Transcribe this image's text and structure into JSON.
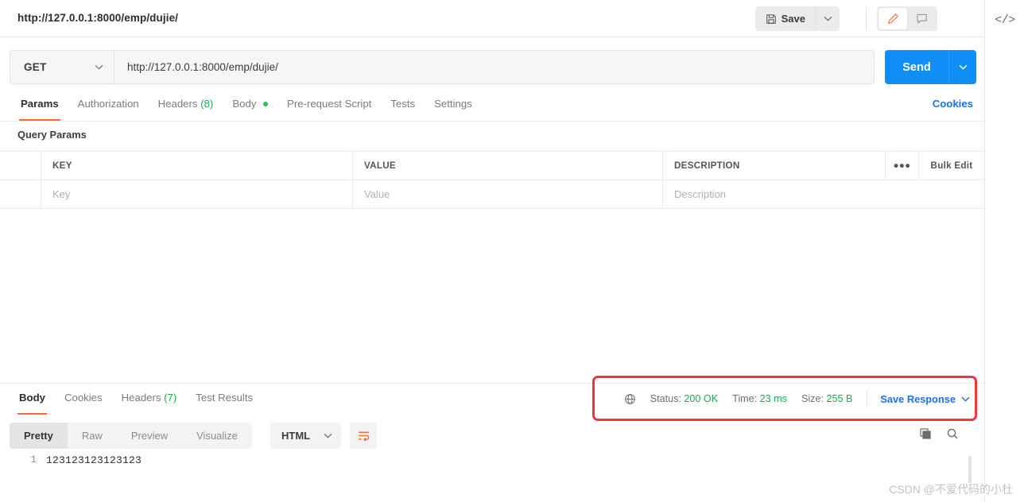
{
  "titlebar": {
    "tab_url": "http://127.0.0.1:8000/emp/dujie/",
    "save_label": "Save",
    "save_icon": "floppy-disk-icon",
    "save_caret_icon": "chevron-down-icon",
    "edit_icon": "pencil-icon",
    "comment_icon": "comment-icon",
    "code_icon": "code-brackets-icon",
    "accent_orange": "#ff6c37"
  },
  "request": {
    "method": "GET",
    "method_caret_icon": "chevron-down-icon",
    "url": "http://127.0.0.1:8000/emp/dujie/",
    "send_label": "Send",
    "send_caret_icon": "chevron-down-icon",
    "send_color": "#0f8ff5"
  },
  "request_tabs": {
    "items": [
      {
        "label": "Params",
        "active": true,
        "count": "",
        "dot": false
      },
      {
        "label": "Authorization",
        "active": false,
        "count": "",
        "dot": false
      },
      {
        "label": "Headers",
        "active": false,
        "count": "(8)",
        "dot": false
      },
      {
        "label": "Body",
        "active": false,
        "count": "",
        "dot": true
      },
      {
        "label": "Pre-request Script",
        "active": false,
        "count": "",
        "dot": false
      },
      {
        "label": "Tests",
        "active": false,
        "count": "",
        "dot": false
      },
      {
        "label": "Settings",
        "active": false,
        "count": "",
        "dot": false
      }
    ],
    "cookies_link": "Cookies"
  },
  "query_params": {
    "section_title": "Query Params",
    "columns": [
      "KEY",
      "VALUE",
      "DESCRIPTION"
    ],
    "more_icon": "ellipsis-icon",
    "bulk_edit_label": "Bulk Edit",
    "rows": [
      {
        "key": "Key",
        "value": "Value",
        "description": "Description"
      }
    ]
  },
  "response_tabs": {
    "items": [
      {
        "label": "Body",
        "active": true,
        "count": ""
      },
      {
        "label": "Cookies",
        "active": false,
        "count": ""
      },
      {
        "label": "Headers",
        "active": false,
        "count": "(7)"
      },
      {
        "label": "Test Results",
        "active": false,
        "count": ""
      }
    ]
  },
  "response_status": {
    "globe_icon": "globe-icon",
    "status_label": "Status:",
    "status_value": "200 OK",
    "time_label": "Time:",
    "time_value": "23 ms",
    "size_label": "Size:",
    "size_value": "255 B",
    "save_response_label": "Save Response",
    "save_response_caret_icon": "chevron-down-icon",
    "value_color": "#1fa855",
    "highlight_color": "#f5333f"
  },
  "format_bar": {
    "segments": [
      {
        "label": "Pretty",
        "active": true
      },
      {
        "label": "Raw",
        "active": false
      },
      {
        "label": "Preview",
        "active": false
      },
      {
        "label": "Visualize",
        "active": false
      }
    ],
    "language": "HTML",
    "language_caret_icon": "chevron-down-icon",
    "wrap_icon": "wrap-lines-icon",
    "copy_icon": "copy-icon",
    "search_icon": "search-icon"
  },
  "response_body": {
    "lines": [
      {
        "number": "1",
        "text": "123123123123123"
      }
    ]
  },
  "watermark": {
    "text": "CSDN @不爱代码的小杜"
  }
}
